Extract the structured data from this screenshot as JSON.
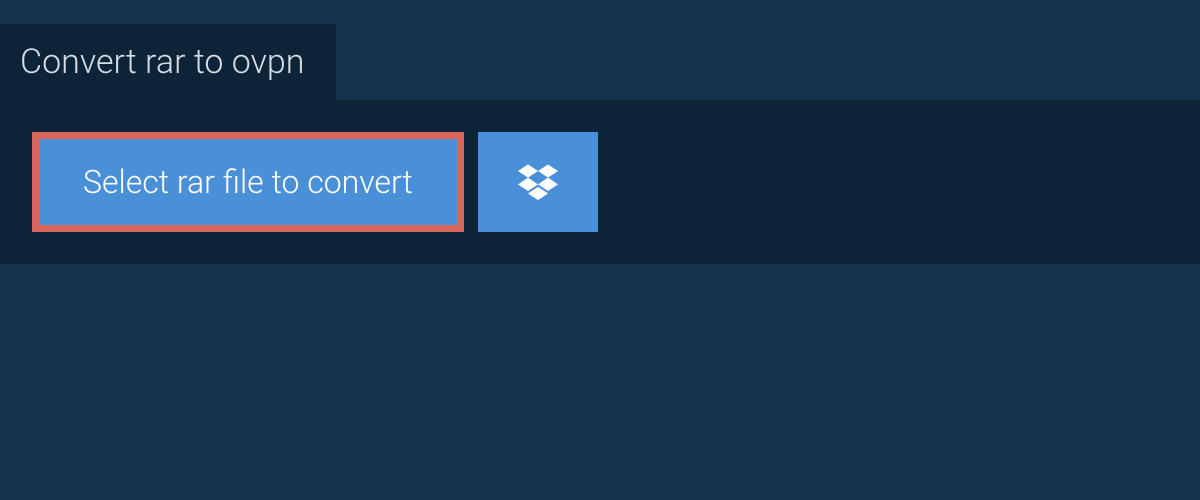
{
  "tab": {
    "title": "Convert rar to ovpn"
  },
  "actions": {
    "select_file_label": "Select rar file to convert"
  },
  "colors": {
    "background": "#13334d",
    "panel": "#0d2438",
    "button": "#4a90d9",
    "button_border": "#d96459",
    "text_light": "#d5dce3",
    "text_white": "#ffffff"
  }
}
